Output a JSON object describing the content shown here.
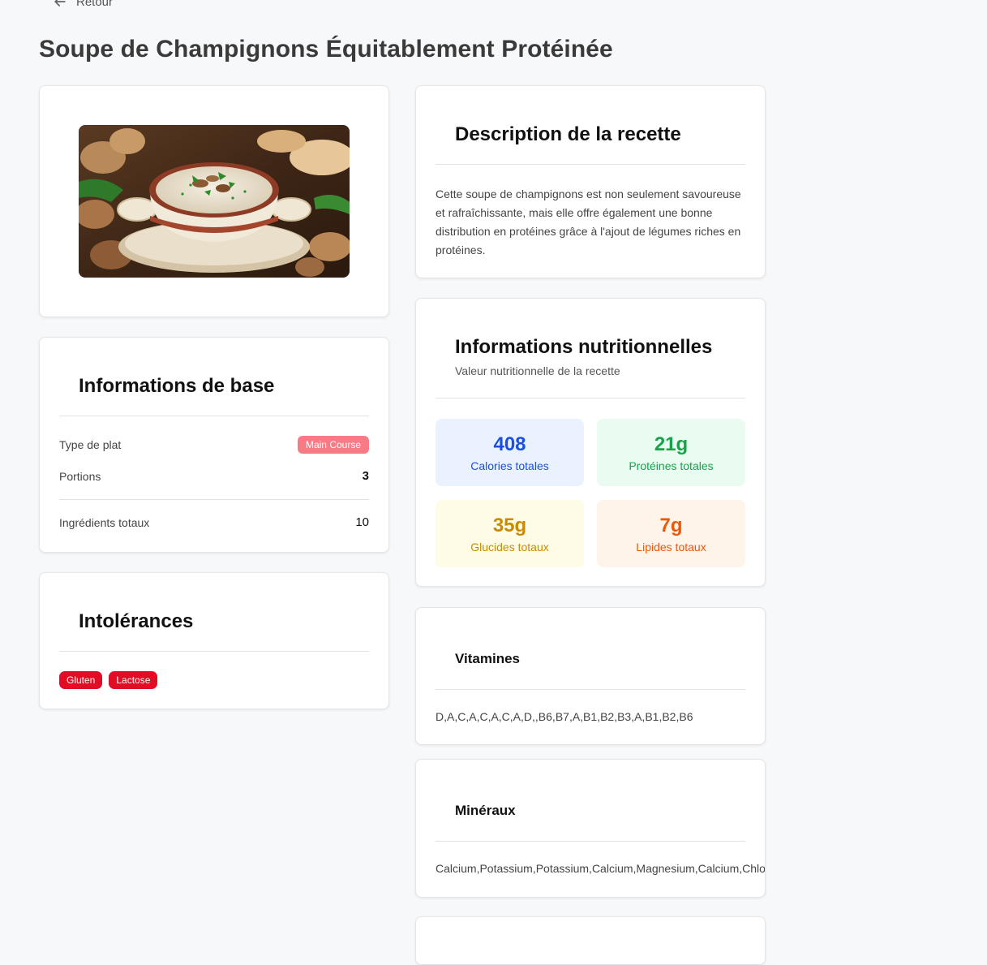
{
  "nav": {
    "back_label": "Retour"
  },
  "page": {
    "title": "Soupe de Champignons Équitablement Protéinée"
  },
  "basic_info": {
    "title": "Informations de base",
    "dish_type_label": "Type de plat",
    "dish_type_value": "Main Course",
    "portions_label": "Portions",
    "portions_value": "3",
    "ingredients_label": "Ingrédients totaux",
    "ingredients_value": "10"
  },
  "intolerances": {
    "title": "Intolérances",
    "tags": [
      "Gluten",
      "Lactose"
    ]
  },
  "description": {
    "title": "Description de la recette",
    "text": "Cette soupe de champignons est non seulement savoureuse et rafraîchissante, mais elle offre également une bonne distribution en protéines grâce à l'ajout de légumes riches en protéines."
  },
  "nutrition": {
    "title": "Informations nutritionnelles",
    "subtitle": "Valeur nutritionnelle de la recette",
    "calories": {
      "value": "408",
      "label": "Calories totales"
    },
    "proteins": {
      "value": "21g",
      "label": "Protéines totales"
    },
    "carbs": {
      "value": "35g",
      "label": "Glucides totaux"
    },
    "fats": {
      "value": "7g",
      "label": "Lipides totaux"
    }
  },
  "vitamins": {
    "title": "Vitamines",
    "list": "D,A,C,A,C,A,C,A,D,,B6,B7,A,B1,B2,B3,A,B1,B2,B6"
  },
  "minerals": {
    "title": "Minéraux",
    "list": "Calcium,Potassium,Potassium,Calcium,Magnesium,Calcium,Chlo"
  },
  "colors": {
    "dish_type_badge": "#f77b84",
    "intolerance_tag": "#e20c25",
    "calories": "#1a4fe0",
    "proteins": "#16a34a",
    "carbs": "#ca8a04",
    "fats": "#ea580c"
  }
}
